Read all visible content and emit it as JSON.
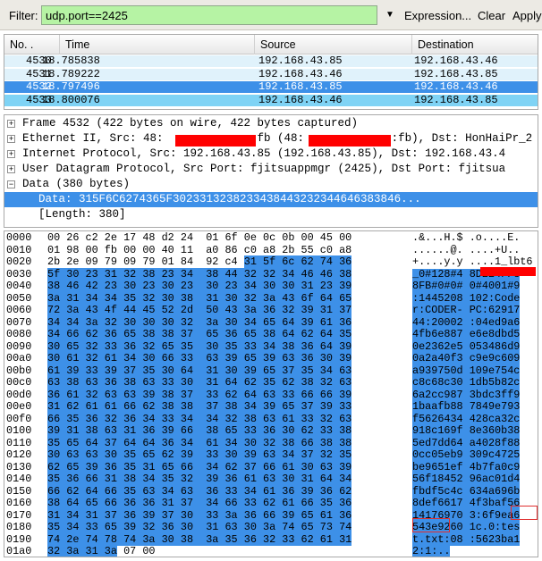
{
  "filter": {
    "label": "Filter:",
    "value": "udp.port==2425",
    "expression_label": "Expression...",
    "clear_label": "Clear",
    "apply_label": "Apply",
    "input_bg": "#b6f3a4"
  },
  "packet_list": {
    "columns": [
      "No. .",
      "Time",
      "Source",
      "Destination"
    ],
    "rows": [
      {
        "no": "4530",
        "time": "18.785838",
        "source": "192.168.43.85",
        "destination": "192.168.43.46",
        "bg": "#e0f2fb",
        "color": "#000000"
      },
      {
        "no": "4531",
        "time": "18.789222",
        "source": "192.168.43.46",
        "destination": "192.168.43.85",
        "bg": "#e0f2fb",
        "color": "#000000"
      },
      {
        "no": "4532",
        "time": "18.797496",
        "source": "192.168.43.85",
        "destination": "192.168.43.46",
        "bg": "#3d90e8",
        "color": "#ffffff"
      },
      {
        "no": "4533",
        "time": "18.800076",
        "source": "192.168.43.46",
        "destination": "192.168.43.85",
        "bg": "#7fd3f5",
        "color": "#000000"
      }
    ]
  },
  "details": {
    "rows": [
      {
        "expander": "+",
        "text": "Frame 4532 (422 bytes on wire, 422 bytes captured)"
      },
      {
        "expander": "+",
        "text": "Ethernet II, Src: 48:             :fb (48:             :fb), Dst: HonHaiPr_2"
      },
      {
        "expander": "+",
        "text": "Internet Protocol, Src: 192.168.43.85 (192.168.43.85), Dst: 192.168.43.4"
      },
      {
        "expander": "+",
        "text": "User Datagram Protocol, Src Port: fjitsuappmgr (2425), Dst Port: fjitsua"
      },
      {
        "expander": "−",
        "text": "Data (380 bytes)"
      }
    ],
    "data_line": "Data: 315F6C6274365F3023313238233438443232344646383846...",
    "length_line": "[Length: 380]",
    "selected_bg": "#3d90e8"
  },
  "bytes": {
    "highlight_color": "#3d90e8",
    "rows": [
      {
        "off": "0000",
        "hex": [
          "00",
          "26",
          "c2",
          "2e",
          "17",
          "48",
          "d2",
          "24",
          "01",
          "6f",
          "0e",
          "0c",
          "0b",
          "00",
          "45",
          "00"
        ],
        "ascii": ".&...H.$ .o....E.",
        "hl_from": 99,
        "hl_to": 99
      },
      {
        "off": "0010",
        "hex": [
          "01",
          "98",
          "00",
          "fb",
          "00",
          "00",
          "40",
          "11",
          "a0",
          "86",
          "c0",
          "a8",
          "2b",
          "55",
          "c0",
          "a8"
        ],
        "ascii": "......@. ....+U..",
        "hl_from": 99,
        "hl_to": 99
      },
      {
        "off": "0020",
        "hex": [
          "2b",
          "2e",
          "09",
          "79",
          "09",
          "79",
          "01",
          "84",
          "92",
          "c4",
          "31",
          "5f",
          "6c",
          "62",
          "74",
          "36"
        ],
        "ascii": "+....y.y ....1_lbt6",
        "hl_from": 10,
        "hl_to": 15
      },
      {
        "off": "0030",
        "hex": [
          "5f",
          "30",
          "23",
          "31",
          "32",
          "38",
          "23",
          "34",
          "38",
          "44",
          "32",
          "32",
          "34",
          "46",
          "46",
          "38"
        ],
        "ascii": "_0#128#4 8D224FF8",
        "hl_from": 0,
        "hl_to": 15
      },
      {
        "off": "0040",
        "hex": [
          "38",
          "46",
          "42",
          "23",
          "30",
          "23",
          "30",
          "23",
          "30",
          "23",
          "34",
          "30",
          "30",
          "31",
          "23",
          "39"
        ],
        "ascii": "8FB#0#0# 0#4001#9",
        "hl_from": 0,
        "hl_to": 15
      },
      {
        "off": "0050",
        "hex": [
          "3a",
          "31",
          "34",
          "34",
          "35",
          "32",
          "30",
          "38",
          "31",
          "30",
          "32",
          "3a",
          "43",
          "6f",
          "64",
          "65"
        ],
        "ascii": ":1445208 102:Code",
        "hl_from": 0,
        "hl_to": 15
      },
      {
        "off": "0060",
        "hex": [
          "72",
          "3a",
          "43",
          "4f",
          "44",
          "45",
          "52",
          "2d",
          "50",
          "43",
          "3a",
          "36",
          "32",
          "39",
          "31",
          "37"
        ],
        "ascii": "r:CODER- PC:62917",
        "hl_from": 0,
        "hl_to": 15
      },
      {
        "off": "0070",
        "hex": [
          "34",
          "34",
          "3a",
          "32",
          "30",
          "30",
          "30",
          "32",
          "3a",
          "30",
          "34",
          "65",
          "64",
          "39",
          "61",
          "36"
        ],
        "ascii": "44:20002 :04ed9a6",
        "hl_from": 0,
        "hl_to": 15
      },
      {
        "off": "0080",
        "hex": [
          "34",
          "66",
          "62",
          "36",
          "65",
          "38",
          "38",
          "37",
          "65",
          "36",
          "65",
          "38",
          "64",
          "62",
          "64",
          "35"
        ],
        "ascii": "4fb6e887 e6e8dbd5",
        "hl_from": 0,
        "hl_to": 15
      },
      {
        "off": "0090",
        "hex": [
          "30",
          "65",
          "32",
          "33",
          "36",
          "32",
          "65",
          "35",
          "30",
          "35",
          "33",
          "34",
          "38",
          "36",
          "64",
          "39"
        ],
        "ascii": "0e2362e5 053486d9",
        "hl_from": 0,
        "hl_to": 15
      },
      {
        "off": "00a0",
        "hex": [
          "30",
          "61",
          "32",
          "61",
          "34",
          "30",
          "66",
          "33",
          "63",
          "39",
          "65",
          "39",
          "63",
          "36",
          "30",
          "39"
        ],
        "ascii": "0a2a40f3 c9e9c609",
        "hl_from": 0,
        "hl_to": 15
      },
      {
        "off": "00b0",
        "hex": [
          "61",
          "39",
          "33",
          "39",
          "37",
          "35",
          "30",
          "64",
          "31",
          "30",
          "39",
          "65",
          "37",
          "35",
          "34",
          "63"
        ],
        "ascii": "a939750d 109e754c",
        "hl_from": 0,
        "hl_to": 15
      },
      {
        "off": "00c0",
        "hex": [
          "63",
          "38",
          "63",
          "36",
          "38",
          "63",
          "33",
          "30",
          "31",
          "64",
          "62",
          "35",
          "62",
          "38",
          "32",
          "63"
        ],
        "ascii": "c8c68c30 1db5b82c",
        "hl_from": 0,
        "hl_to": 15
      },
      {
        "off": "00d0",
        "hex": [
          "36",
          "61",
          "32",
          "63",
          "63",
          "39",
          "38",
          "37",
          "33",
          "62",
          "64",
          "63",
          "33",
          "66",
          "66",
          "39"
        ],
        "ascii": "6a2cc987 3bdc3ff9",
        "hl_from": 0,
        "hl_to": 15
      },
      {
        "off": "00e0",
        "hex": [
          "31",
          "62",
          "61",
          "61",
          "66",
          "62",
          "38",
          "38",
          "37",
          "38",
          "34",
          "39",
          "65",
          "37",
          "39",
          "33"
        ],
        "ascii": "1baafb88 7849e793",
        "hl_from": 0,
        "hl_to": 15
      },
      {
        "off": "00f0",
        "hex": [
          "66",
          "35",
          "36",
          "32",
          "36",
          "34",
          "33",
          "34",
          "34",
          "32",
          "38",
          "63",
          "61",
          "33",
          "32",
          "63"
        ],
        "ascii": "f5626434 428ca32c",
        "hl_from": 0,
        "hl_to": 15
      },
      {
        "off": "0100",
        "hex": [
          "39",
          "31",
          "38",
          "63",
          "31",
          "36",
          "39",
          "66",
          "38",
          "65",
          "33",
          "36",
          "30",
          "62",
          "33",
          "38"
        ],
        "ascii": "918c169f 8e360b38",
        "hl_from": 0,
        "hl_to": 15
      },
      {
        "off": "0110",
        "hex": [
          "35",
          "65",
          "64",
          "37",
          "64",
          "64",
          "36",
          "34",
          "61",
          "34",
          "30",
          "32",
          "38",
          "66",
          "38",
          "38"
        ],
        "ascii": "5ed7dd64 a4028f88",
        "hl_from": 0,
        "hl_to": 15
      },
      {
        "off": "0120",
        "hex": [
          "30",
          "63",
          "63",
          "30",
          "35",
          "65",
          "62",
          "39",
          "33",
          "30",
          "39",
          "63",
          "34",
          "37",
          "32",
          "35"
        ],
        "ascii": "0cc05eb9 309c4725",
        "hl_from": 0,
        "hl_to": 15
      },
      {
        "off": "0130",
        "hex": [
          "62",
          "65",
          "39",
          "36",
          "35",
          "31",
          "65",
          "66",
          "34",
          "62",
          "37",
          "66",
          "61",
          "30",
          "63",
          "39"
        ],
        "ascii": "be9651ef 4b7fa0c9",
        "hl_from": 0,
        "hl_to": 15
      },
      {
        "off": "0140",
        "hex": [
          "35",
          "36",
          "66",
          "31",
          "38",
          "34",
          "35",
          "32",
          "39",
          "36",
          "61",
          "63",
          "30",
          "31",
          "64",
          "34"
        ],
        "ascii": "56f18452 96ac01d4",
        "hl_from": 0,
        "hl_to": 15
      },
      {
        "off": "0150",
        "hex": [
          "66",
          "62",
          "64",
          "66",
          "35",
          "63",
          "34",
          "63",
          "36",
          "33",
          "34",
          "61",
          "36",
          "39",
          "36",
          "62"
        ],
        "ascii": "fbdf5c4c 634a696b",
        "hl_from": 0,
        "hl_to": 15
      },
      {
        "off": "0160",
        "hex": [
          "38",
          "64",
          "65",
          "66",
          "36",
          "36",
          "31",
          "37",
          "34",
          "66",
          "33",
          "62",
          "61",
          "66",
          "35",
          "36"
        ],
        "ascii": "8def6617 4f3baf56",
        "hl_from": 0,
        "hl_to": 15
      },
      {
        "off": "0170",
        "hex": [
          "31",
          "34",
          "31",
          "37",
          "36",
          "39",
          "37",
          "30",
          "33",
          "3a",
          "36",
          "66",
          "39",
          "65",
          "61",
          "36"
        ],
        "ascii": "14176970 3:6f9ea6",
        "hl_from": 0,
        "hl_to": 15
      },
      {
        "off": "0180",
        "hex": [
          "35",
          "34",
          "33",
          "65",
          "39",
          "32",
          "36",
          "30",
          "31",
          "63",
          "30",
          "3a",
          "74",
          "65",
          "73",
          "74"
        ],
        "ascii": "543e9260 1c.0:tes",
        "hl_from": 0,
        "hl_to": 15
      },
      {
        "off": "0190",
        "hex": [
          "74",
          "2e",
          "74",
          "78",
          "74",
          "3a",
          "30",
          "38",
          "3a",
          "35",
          "36",
          "32",
          "33",
          "62",
          "61",
          "31"
        ],
        "ascii": "t.txt:08 :5623ba1",
        "hl_from": 0,
        "hl_to": 15
      },
      {
        "off": "01a0",
        "hex": [
          "32",
          "3a",
          "31",
          "3a",
          "07",
          "00"
        ],
        "ascii": "2:1:..",
        "hl_from": 0,
        "hl_to": 3
      }
    ]
  }
}
